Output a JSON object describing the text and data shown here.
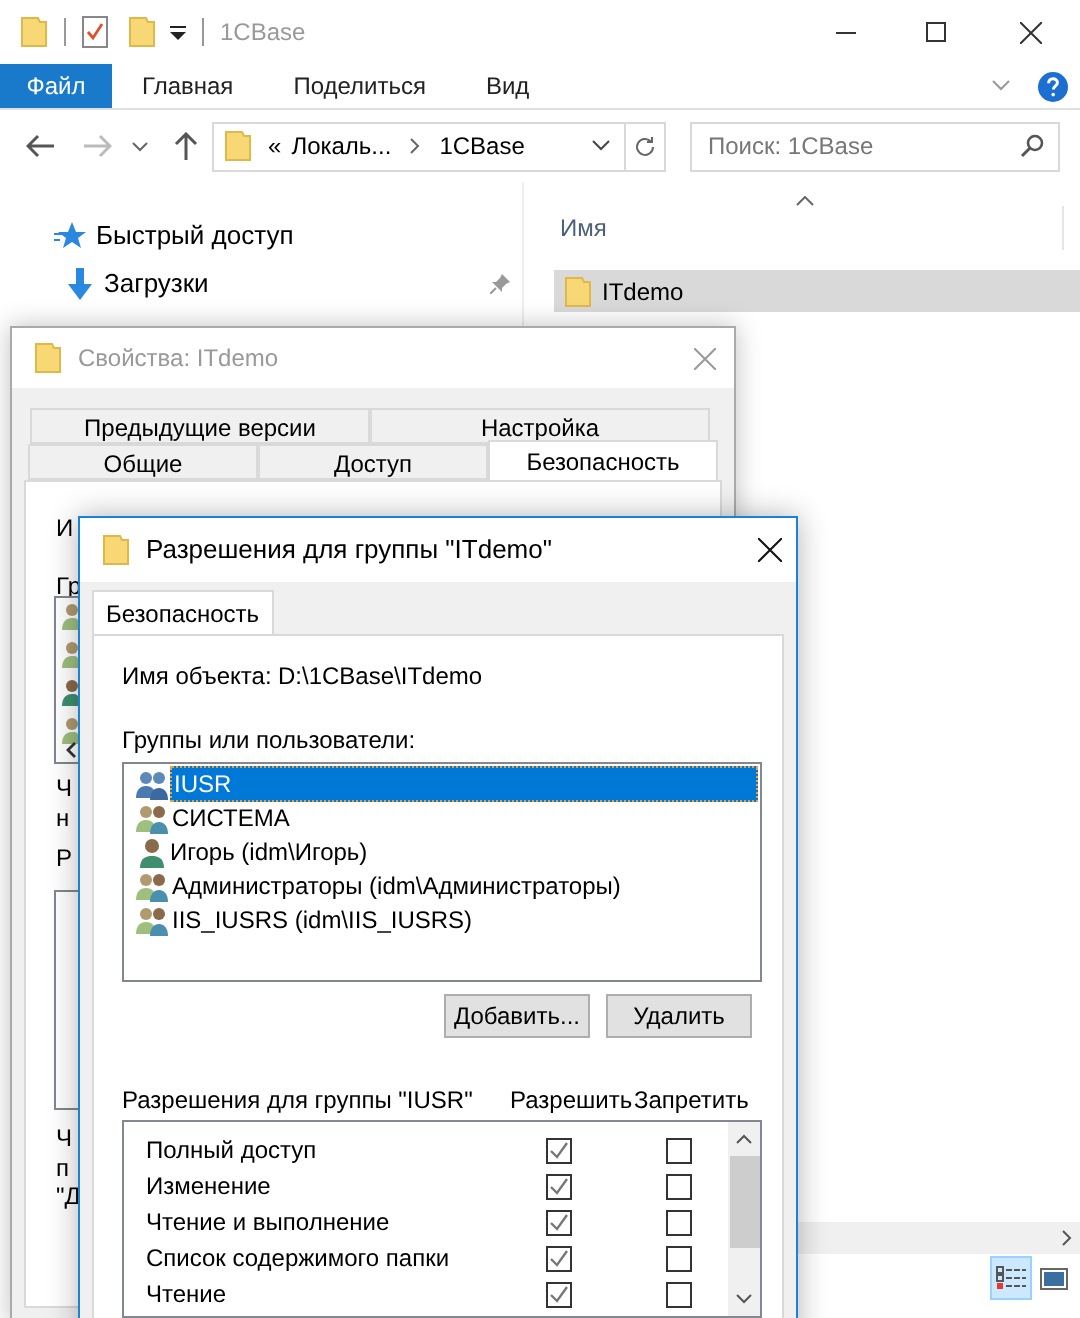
{
  "explorer": {
    "title": "1CBase",
    "ribbon_tabs": [
      {
        "label": "Файл",
        "selected": true
      },
      {
        "label": "Главная",
        "selected": false
      },
      {
        "label": "Поделиться",
        "selected": false
      },
      {
        "label": "Вид",
        "selected": false
      }
    ],
    "address": {
      "crumbs": [
        "«",
        "Локаль...",
        "1CBase"
      ]
    },
    "search": {
      "placeholder": "Поиск: 1CBase"
    },
    "nav": [
      {
        "label": "Быстрый доступ",
        "kind": "star"
      },
      {
        "label": "Загрузки",
        "kind": "download"
      }
    ],
    "column": "Имя",
    "files": [
      {
        "name": "ITdemo",
        "selected": true
      }
    ]
  },
  "properties": {
    "title": "Свойства: ITdemo",
    "tab_rows": [
      [
        {
          "label": "Предыдущие версии",
          "selected": false
        },
        {
          "label": "Настройка",
          "selected": false
        }
      ],
      [
        {
          "label": "Общие",
          "selected": false
        },
        {
          "label": "Доступ",
          "selected": false
        },
        {
          "label": "Безопасность",
          "selected": true
        }
      ]
    ],
    "fragments": [
      "И",
      "Гр",
      "Ч",
      "н",
      "Р",
      "Ч",
      "п",
      "\"Д"
    ]
  },
  "permissions": {
    "title": "Разрешения для группы \"ITdemo\"",
    "tab": "Безопасность",
    "object_label": "Имя объекта:",
    "object_value": "D:\\1CBase\\ITdemo",
    "groups_label": "Группы или пользователи:",
    "users": [
      {
        "name": "IUSR",
        "kind": "group",
        "selected": true
      },
      {
        "name": "СИСТЕМА",
        "kind": "group",
        "selected": false
      },
      {
        "name": "Игорь (idm\\Игорь)",
        "kind": "user",
        "selected": false
      },
      {
        "name": "Администраторы (idm\\Администраторы)",
        "kind": "group",
        "selected": false
      },
      {
        "name": "IIS_IUSRS (idm\\IIS_IUSRS)",
        "kind": "group",
        "selected": false
      }
    ],
    "buttons": [
      "Добавить...",
      "Удалить"
    ],
    "perm_label": "Разрешения для группы \"IUSR\"",
    "allow_label": "Разрешить",
    "deny_label": "Запретить",
    "perms": [
      {
        "name": "Полный доступ",
        "allow": true,
        "deny": false
      },
      {
        "name": "Изменение",
        "allow": true,
        "deny": false
      },
      {
        "name": "Чтение и выполнение",
        "allow": true,
        "deny": false
      },
      {
        "name": "Список содержимого папки",
        "allow": true,
        "deny": false
      },
      {
        "name": "Чтение",
        "allow": true,
        "deny": false
      }
    ]
  }
}
